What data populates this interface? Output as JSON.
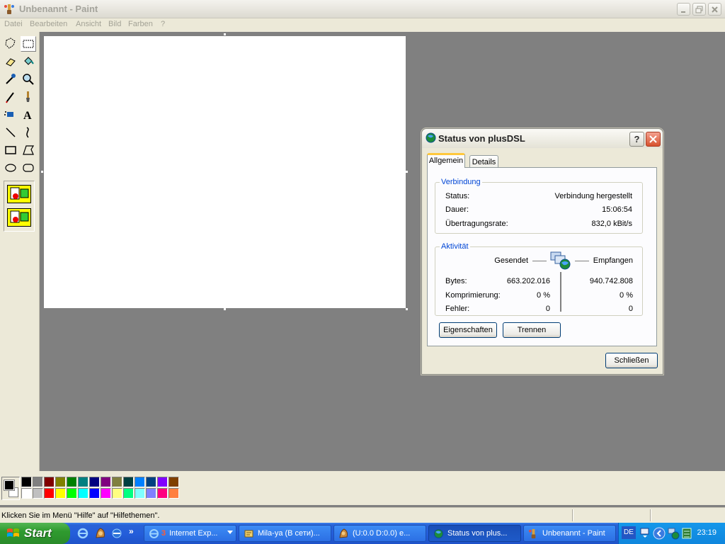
{
  "window": {
    "title": "Unbenannt - Paint"
  },
  "menu": [
    "Datei",
    "Bearbeiten",
    "Ansicht",
    "Bild",
    "Farben",
    "?"
  ],
  "tools": [
    "free-select",
    "rect-select",
    "eraser",
    "fill",
    "color-picker",
    "magnifier",
    "pencil",
    "brush",
    "airbrush",
    "text",
    "line",
    "curve",
    "rectangle",
    "polygon",
    "ellipse",
    "rounded-rectangle"
  ],
  "palette": {
    "primary": "#000000",
    "secondary": "#ffffff",
    "row1": [
      "#000000",
      "#808080",
      "#800000",
      "#808000",
      "#008000",
      "#008080",
      "#000080",
      "#800080",
      "#808040",
      "#004040",
      "#0080ff",
      "#004080",
      "#8000ff",
      "#804000"
    ],
    "row2": [
      "#ffffff",
      "#c0c0c0",
      "#ff0000",
      "#ffff00",
      "#00ff00",
      "#00ffff",
      "#0000ff",
      "#ff00ff",
      "#ffff80",
      "#00ff80",
      "#80ffff",
      "#8080ff",
      "#ff0080",
      "#ff8040"
    ]
  },
  "status": {
    "text": "Klicken Sie im Menü \"Hilfe\" auf \"Hilfethemen\"."
  },
  "dialog": {
    "title": "Status von plusDSL",
    "help": "?",
    "tabs": [
      "Allgemein",
      "Details"
    ],
    "connection": {
      "legend": "Verbindung",
      "status_label": "Status:",
      "status_value": "Verbindung hergestellt",
      "duration_label": "Dauer:",
      "duration_value": "15:06:54",
      "rate_label": "Übertragungsrate:",
      "rate_value": "832,0 kBit/s"
    },
    "activity": {
      "legend": "Aktivität",
      "sent_label": "Gesendet",
      "received_label": "Empfangen",
      "bytes_label": "Bytes:",
      "bytes_sent": "663.202.016",
      "bytes_received": "940.742.808",
      "compression_label": "Komprimierung:",
      "compression_sent": "0 %",
      "compression_received": "0 %",
      "errors_label": "Fehler:",
      "errors_sent": "0",
      "errors_received": "0"
    },
    "buttons": {
      "properties": "Eigenschaften",
      "disconnect": "Trennen",
      "close": "Schließen"
    }
  },
  "taskbar": {
    "start": "Start",
    "tasks": [
      {
        "badge": "3",
        "label": "Internet Exp..."
      },
      {
        "label": "Mila-ya (В сети)..."
      },
      {
        "label": "(U:0.0 D:0.0) e..."
      },
      {
        "label": "Status von plus..."
      },
      {
        "label": "Unbenannt - Paint"
      }
    ],
    "language": "DE",
    "clock": "23:19"
  }
}
